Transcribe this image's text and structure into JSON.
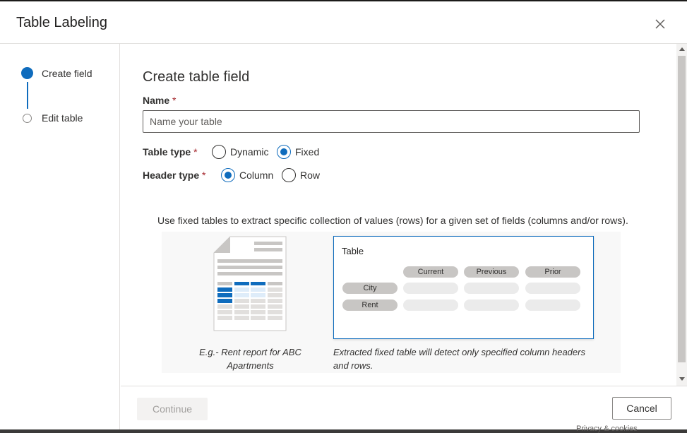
{
  "dialog": {
    "title": "Table Labeling",
    "close_icon": "close-icon"
  },
  "steps": [
    {
      "label": "Create field",
      "state": "active"
    },
    {
      "label": "Edit table",
      "state": "inactive"
    }
  ],
  "form": {
    "heading": "Create table field",
    "name_label": "Name",
    "required_marker": "*",
    "name_value": "",
    "name_placeholder": "Name your table",
    "table_type_label": "Table type",
    "table_type_options": [
      {
        "label": "Dynamic",
        "checked": false
      },
      {
        "label": "Fixed",
        "checked": true
      }
    ],
    "header_type_label": "Header type",
    "header_type_options": [
      {
        "label": "Column",
        "checked": true
      },
      {
        "label": "Row",
        "checked": false
      }
    ]
  },
  "illustration": {
    "description": "Use fixed tables to extract specific collection of values (rows) for a given set of fields (columns and/or rows).",
    "doc_caption": "E.g.- Rent report for ABC Apartments",
    "table_title": "Table",
    "column_headers": [
      "Current",
      "Previous",
      "Prior"
    ],
    "row_headers": [
      "City",
      "Rent"
    ],
    "table_caption": "Extracted fixed table will detect only specified column headers and rows."
  },
  "footer": {
    "continue_label": "Continue",
    "cancel_label": "Cancel"
  },
  "background": {
    "ghost_text": "Privacy & cookies"
  },
  "colors": {
    "accent": "#0f6cbd",
    "required": "#a4262c",
    "pill": "#c8c6c4",
    "pill_empty": "#ebebeb"
  }
}
